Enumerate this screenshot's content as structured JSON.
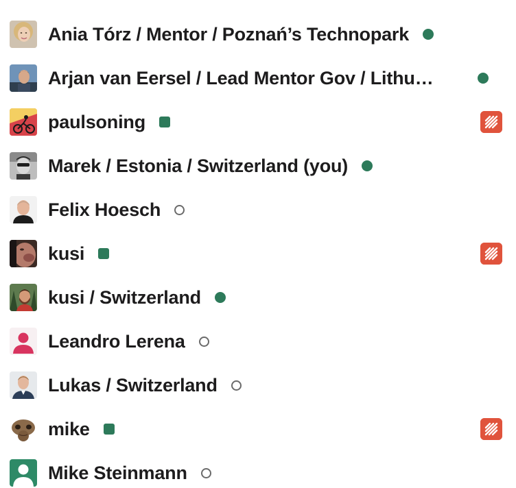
{
  "members": [
    {
      "name": "Ania Tórz / Mentor / Poznań’s Technopark",
      "presence": "active",
      "avatar": "photo-avatar-woman-blonde",
      "app_badge": false
    },
    {
      "name": "Arjan van Eersel / Lead Mentor Gov / Lithu…",
      "presence": "active",
      "avatar": "photo-avatar-man-outdoor",
      "app_badge": false
    },
    {
      "name": "paulsoning",
      "presence": "bot",
      "avatar": "photo-avatar-cyclist",
      "app_badge": true
    },
    {
      "name": "Marek / Estonia / Switzerland (you)",
      "presence": "active",
      "avatar": "photo-avatar-man-sunglasses-bw",
      "app_badge": false
    },
    {
      "name": "Felix Hoesch",
      "presence": "away",
      "avatar": "photo-avatar-man-bald",
      "app_badge": false
    },
    {
      "name": "kusi",
      "presence": "bot",
      "avatar": "photo-avatar-closeup",
      "app_badge": true
    },
    {
      "name": "kusi / Switzerland",
      "presence": "active",
      "avatar": "photo-avatar-man-beard-forest",
      "app_badge": false
    },
    {
      "name": "Leandro Lerena",
      "presence": "away",
      "avatar": "default-avatar-pink",
      "app_badge": false
    },
    {
      "name": "Lukas / Switzerland",
      "presence": "away",
      "avatar": "photo-avatar-man-suit",
      "app_badge": false
    },
    {
      "name": "mike",
      "presence": "bot",
      "avatar": "photo-avatar-et-alien",
      "app_badge": true
    },
    {
      "name": "Mike Steinmann",
      "presence": "away",
      "avatar": "default-avatar-green",
      "app_badge": false
    }
  ],
  "colors": {
    "active": "#2d7a5a",
    "away_ring": "#6a6a6a",
    "app_badge": "#e0533c",
    "default_avatar_pink": "#d8345f",
    "default_avatar_green": "#2e8a67"
  },
  "icons": {
    "app_badge_icon": "striped-square-app-icon"
  }
}
